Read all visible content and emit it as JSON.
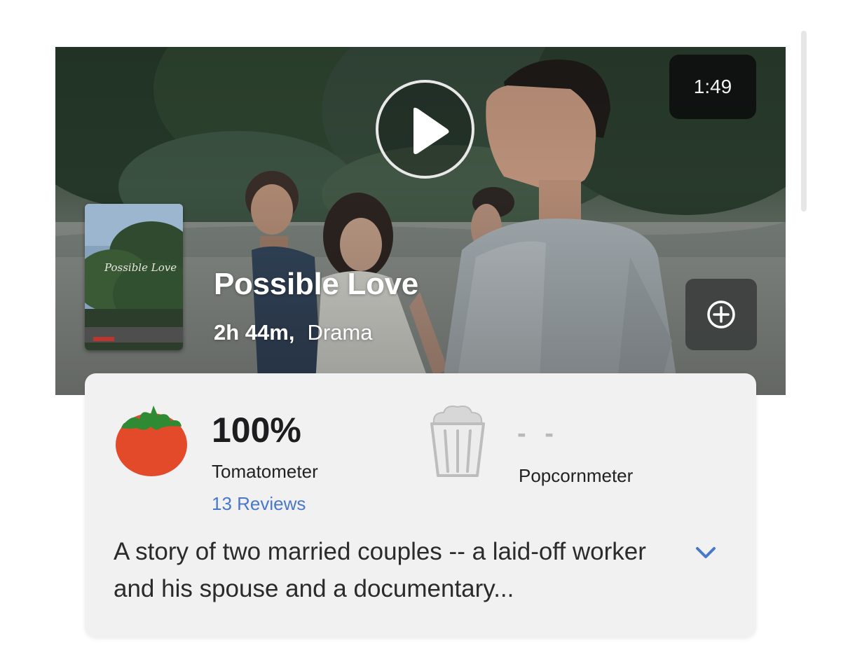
{
  "trailer": {
    "duration": "1:49",
    "icons": {
      "play": "play-icon",
      "add": "plus-circle-icon"
    }
  },
  "movie": {
    "title": "Possible Love",
    "runtime": "2h 44m,",
    "genre": "Drama",
    "poster_title": "Possible Love"
  },
  "scores": {
    "tomatometer": {
      "value": "100%",
      "label": "Tomatometer",
      "reviews": "13 Reviews",
      "icon": "tomato-icon"
    },
    "popcornmeter": {
      "value": "- -",
      "label": "Popcornmeter",
      "icon": "empty-popcorn-bucket-icon"
    }
  },
  "synopsis": {
    "text": "A story of two married couples -- a laid-off worker and his spouse and a documentary...",
    "expand_icon": "chevron-down-icon"
  },
  "colors": {
    "link": "#4a78c9",
    "tomato": "#e24a2a",
    "card_background": "#f1f1f1"
  }
}
